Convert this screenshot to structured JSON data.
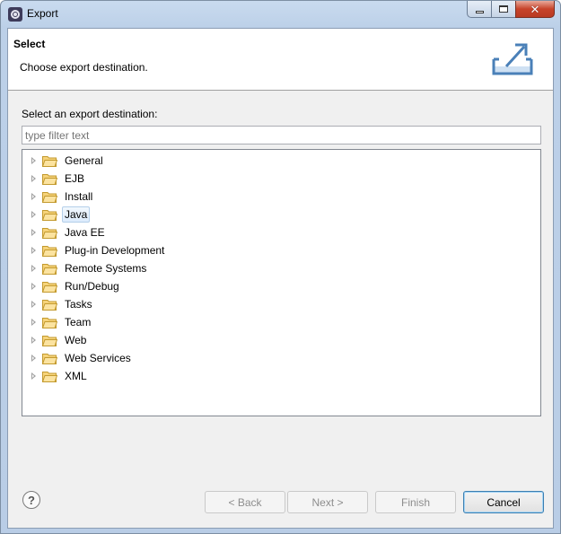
{
  "window": {
    "title": "Export",
    "app_icon": "eclipse-icon"
  },
  "caption": {
    "minimize_icon": "minimize-icon",
    "maximize_icon": "maximize-icon",
    "close_glyph": "✕"
  },
  "banner": {
    "title": "Select",
    "description": "Choose export destination.",
    "icon": "export-wizard-icon"
  },
  "selector": {
    "label": "Select an export destination:",
    "filter_placeholder": "type filter text",
    "filter_value": "",
    "items": [
      {
        "label": "General"
      },
      {
        "label": "EJB"
      },
      {
        "label": "Install"
      },
      {
        "label": "Java",
        "selected": true
      },
      {
        "label": "Java EE"
      },
      {
        "label": "Plug-in Development"
      },
      {
        "label": "Remote Systems"
      },
      {
        "label": "Run/Debug"
      },
      {
        "label": "Tasks"
      },
      {
        "label": "Team"
      },
      {
        "label": "Web"
      },
      {
        "label": "Web Services"
      },
      {
        "label": "XML"
      }
    ]
  },
  "footer": {
    "help_glyph": "?",
    "back_label": "< Back",
    "next_label": "Next >",
    "finish_label": "Finish",
    "cancel_label": "Cancel"
  },
  "colors": {
    "folder": "#f0c75e",
    "selection_border": "#b4cfe9",
    "title_gradient": "#c9dbef"
  }
}
